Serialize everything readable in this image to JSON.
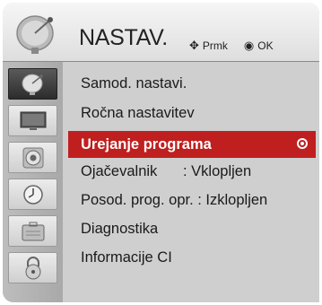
{
  "header": {
    "title": "NASTAV.",
    "move_glyph": "✥",
    "move_label": "Prmk",
    "ok_glyph": "◉",
    "ok_label": "OK",
    "icon": "satellite-dish-icon"
  },
  "sidebar": {
    "items": [
      {
        "icon": "satellite-dish-icon",
        "active": true
      },
      {
        "icon": "monitor-icon"
      },
      {
        "icon": "speaker-icon"
      },
      {
        "icon": "clock-icon"
      },
      {
        "icon": "briefcase-icon"
      },
      {
        "icon": "lock-icon"
      }
    ]
  },
  "menu": {
    "items": [
      {
        "label": "Samod. nastavi."
      },
      {
        "label": "Ročna nastavitev"
      },
      {
        "label": "Urejanje programa",
        "selected": true
      },
      {
        "label": "Ojačevalnik",
        "value": ": Vklopljen"
      },
      {
        "label": "Posod. prog. opr. : Izklopljen"
      },
      {
        "label": "Diagnostika"
      },
      {
        "label": "Informacije CI"
      }
    ]
  },
  "colors": {
    "selection": "#c01f1f",
    "background": "#cfcfcf"
  }
}
